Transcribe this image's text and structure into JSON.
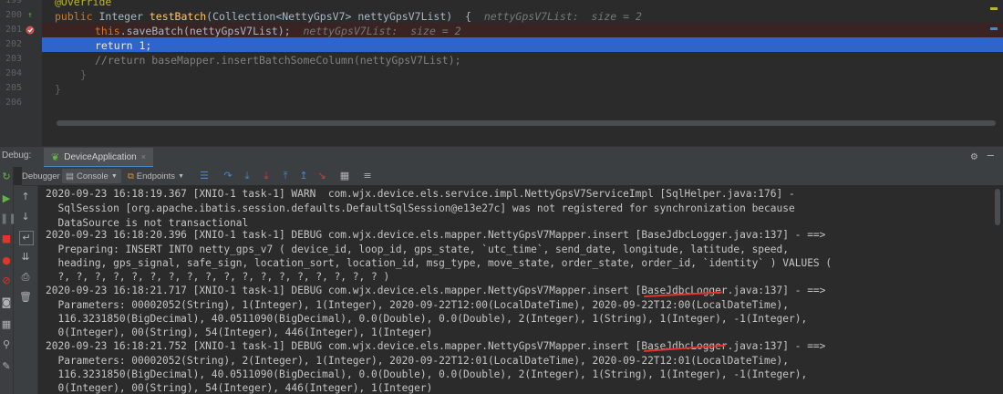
{
  "editor": {
    "gutter_numbers": [
      "199",
      "200",
      "201",
      "202",
      "203",
      "204",
      "205",
      "206"
    ],
    "lines": {
      "annotation": "@Override",
      "sig_kw": "public",
      "sig_type": " Integer ",
      "sig_name": "testBatch",
      "sig_rest": "(Collection<NettyGpsV7> nettyGpsV7List)  {",
      "sig_hint": "  nettyGpsV7List:  size = 2",
      "call_kw": "this",
      "call_rest": ".saveBatch(nettyGpsV7List);",
      "call_hint": "  nettyGpsV7List:  size = 2",
      "ret_kw": "return",
      "ret_rest": " 1;",
      "comment": "//return baseMapper.insertBatchSomeColumn(nettyGpsV7List);",
      "close_brace": "}",
      "close_class": "}"
    }
  },
  "debug_bar": {
    "label": "Debug:",
    "run_tab_label": "DeviceApplication",
    "close_glyph": "×"
  },
  "toolbar": {
    "debugger_label": "Debugger",
    "console_label": "Console",
    "endpoints_label": "Endpoints"
  },
  "console": {
    "lines": [
      "2020-09-23 16:18:19.367 [XNIO-1 task-1] WARN  com.wjx.device.els.service.impl.NettyGpsV7ServiceImpl [SqlHelper.java:176] -",
      "  SqlSession [org.apache.ibatis.session.defaults.DefaultSqlSession@e13e27c] was not registered for synchronization because",
      "  DataSource is not transactional",
      "2020-09-23 16:18:20.396 [XNIO-1 task-1] DEBUG com.wjx.device.els.mapper.NettyGpsV7Mapper.insert [BaseJdbcLogger.java:137] - ==>",
      "  Preparing: INSERT INTO netty_gps_v7 ( device_id, loop_id, gps_state, `utc_time`, send_date, longitude, latitude, speed,",
      "  heading, gps_signal, safe_sign, location_sort, location_id, msg_type, move_state, order_state, order_id, `identity` ) VALUES (",
      "  ?, ?, ?, ?, ?, ?, ?, ?, ?, ?, ?, ?, ?, ?, ?, ?, ?, ? )",
      "2020-09-23 16:18:21.717 [XNIO-1 task-1] DEBUG com.wjx.device.els.mapper.NettyGpsV7Mapper.insert [BaseJdbcLogger.java:137] - ==>",
      "  Parameters: 00002052(String), 1(Integer), 1(Integer), 2020-09-22T12:00(LocalDateTime), 2020-09-22T12:00(LocalDateTime),",
      "  116.3231850(BigDecimal), 40.0511090(BigDecimal), 0.0(Double), 0.0(Double), 2(Integer), 1(String), 1(Integer), -1(Integer),",
      "  0(Integer), 00(String), 54(Integer), 446(Integer), 1(Integer)",
      "2020-09-23 16:18:21.752 [XNIO-1 task-1] DEBUG com.wjx.device.els.mapper.NettyGpsV7Mapper.insert [BaseJdbcLogger.java:137] - ==>",
      "  Parameters: 00002052(String), 2(Integer), 1(Integer), 2020-09-22T12:01(LocalDateTime), 2020-09-22T12:01(LocalDateTime),",
      "  116.3231850(BigDecimal), 40.0511090(BigDecimal), 0.0(Double), 0.0(Double), 2(Integer), 1(String), 1(Integer), -1(Integer),",
      "  0(Integer), 00(String), 54(Integer), 446(Integer), 1(Integer)"
    ]
  }
}
